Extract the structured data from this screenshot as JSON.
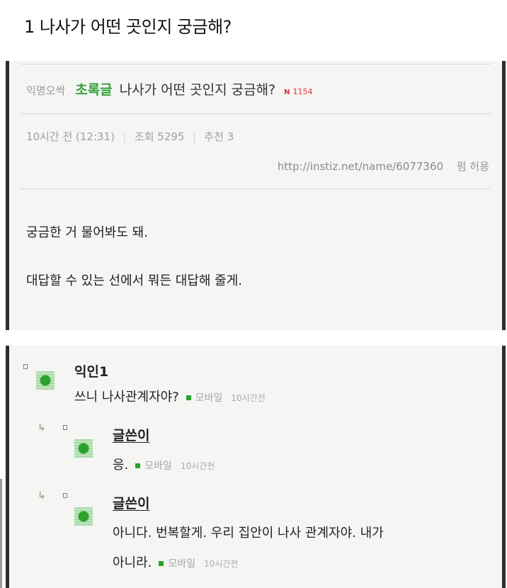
{
  "page": {
    "title": "1 나사가 어떤 곳인지 궁금해?"
  },
  "post": {
    "author": "익명오싹",
    "category": "초록글",
    "subject": "나사가 어떤 곳인지 궁금해?",
    "new_mark": "N",
    "comment_count": "1154",
    "time": "10시간 전 (12:31)",
    "views": "조회 5295",
    "likes": "추천 3",
    "url": "http://instiz.net/name/6077360",
    "permission": "펌 허용",
    "body": [
      "궁금한 거 물어봐도 돼.",
      "대답할 수 있는 선에서 뭐든 대답해 줄게."
    ],
    "colors": {
      "accent": "#35a33a",
      "frame": "#2e2e2e",
      "card_bg": "#f5f5f3"
    }
  },
  "comments": [
    {
      "name": "익인1",
      "text": "쓰니 나사관계자야?",
      "device": "모바일",
      "time": "10시간전"
    },
    {
      "name": "글쓴이",
      "text": "응.",
      "device": "모바일",
      "time": "10시간전"
    },
    {
      "name": "글쓴이",
      "text_line1": "아니다. 번복할게. 우리 집안이 나사 관계자야. 내가",
      "text_line2": "아니라.",
      "device": "모바일",
      "time": "10시간전"
    }
  ],
  "icons": {
    "reply": "reply-arrow-icon",
    "avatar": "anonymous-avatar-icon",
    "mobile": "mobile-square-icon"
  }
}
